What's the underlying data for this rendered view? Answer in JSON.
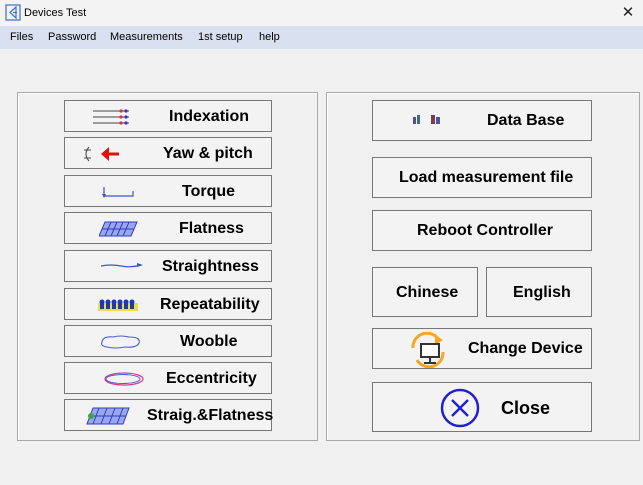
{
  "window": {
    "title": "Devices Test",
    "close_icon": "close-icon"
  },
  "menu": [
    "Files",
    "Password",
    "Measurements",
    "1st setup",
    "help"
  ],
  "left_buttons": [
    {
      "label": "Indexation",
      "icon": "indexation-icon"
    },
    {
      "label": "Yaw & pitch",
      "icon": "yaw-pitch-icon"
    },
    {
      "label": "Torque",
      "icon": "torque-icon"
    },
    {
      "label": "Flatness",
      "icon": "flatness-icon"
    },
    {
      "label": "Straightness",
      "icon": "straightness-icon"
    },
    {
      "label": "Repeatability",
      "icon": "repeatability-icon"
    },
    {
      "label": "Wooble",
      "icon": "wooble-icon"
    },
    {
      "label": "Eccentricity",
      "icon": "eccentricity-icon"
    },
    {
      "label": "Straig.&Flatness",
      "icon": "straig-flatness-icon"
    }
  ],
  "right_buttons": {
    "database": "Data Base",
    "load": "Load measurement file",
    "reboot": "Reboot Controller",
    "chinese": "Chinese",
    "english": "English",
    "change_device": "Change Device",
    "close": "Close"
  },
  "colors": {
    "menubar": "#d9e0ef",
    "close_accent": "#2222cc",
    "change_device_accent": "#f5a623"
  }
}
